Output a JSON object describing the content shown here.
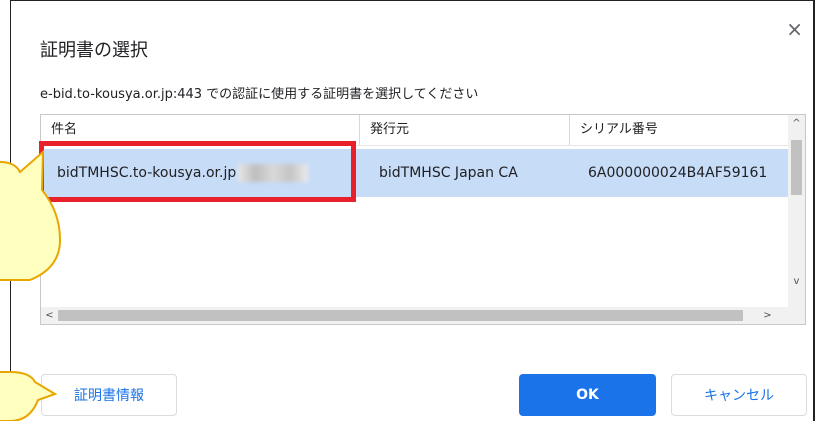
{
  "dialog": {
    "title": "証明書の選択",
    "close_glyph": "×",
    "subtitle": "e-bid.to-kousya.or.jp:443 での認証に使用する証明書を選択してください"
  },
  "table": {
    "columns": [
      "件名",
      "発行元",
      "シリアル番号"
    ],
    "rows": [
      {
        "subject": "bidTMHSC.to-kousya.or.jp",
        "issuer": "bidTMHSC Japan CA",
        "serial": "6A000000024B4AF59161"
      }
    ],
    "scroll_up": "^",
    "scroll_down": "v",
    "scroll_left": "<",
    "scroll_right": ">"
  },
  "buttons": {
    "cert_info": "証明書情報",
    "ok": "OK",
    "cancel": "キャンセル"
  },
  "colors": {
    "accent": "#1a73e8",
    "selected_row": "#c7dcf7",
    "highlight_border": "#e8202a",
    "callout_fill": "#ffffc0",
    "callout_stroke": "#e8a600"
  }
}
